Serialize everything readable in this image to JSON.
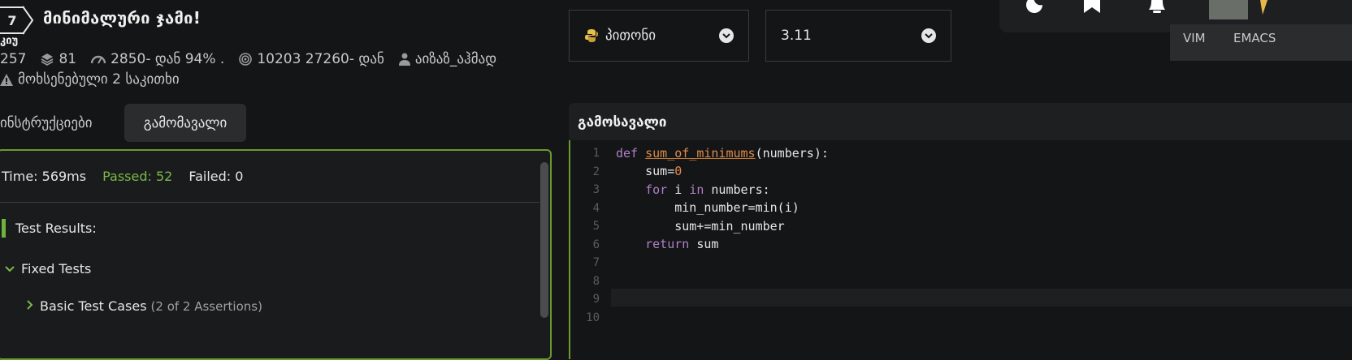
{
  "kata": {
    "rank": "7",
    "rank_label": "კიუ",
    "title": "მინიმალური ჯამი!",
    "stats": {
      "completed": "257",
      "collections": "81",
      "satisfaction": "2850- დან 94% .",
      "stars": "10203 27260- დან",
      "author": "აიზაზ_აჰმად"
    },
    "issues": "მოხსენებული 2 საკითხი"
  },
  "tabs": {
    "instructions": "ინსტრუქციები",
    "output": "გამომავალი"
  },
  "results": {
    "time": "Time: 569ms",
    "passed": "Passed: 52",
    "failed": "Failed: 0",
    "title": "Test Results:",
    "fixed": "Fixed Tests",
    "basic": "Basic Test Cases",
    "basic_count": "(2 of 2 Assertions)"
  },
  "language": {
    "label": "პითონი",
    "version": "3.11"
  },
  "editor": {
    "title": "გამოსავალი",
    "modes": [
      "VIM",
      "EMACS"
    ],
    "line_numbers": [
      "1",
      "2",
      "3",
      "4",
      "5",
      "6",
      "7",
      "8",
      "9",
      "10"
    ],
    "code": {
      "l1_def": "def",
      "l1_fn": "sum_of_minimums",
      "l1_rest": "(numbers):",
      "l2_a": "    sum=",
      "l2_num": "0",
      "l3_for": "for",
      "l3_i": " i ",
      "l3_in": "in",
      "l3_rest": " numbers:",
      "l4": "        min_number=min(i)",
      "l5": "        sum+=min_number",
      "l6_ret": "return",
      "l6_rest": " sum"
    }
  },
  "colors": {
    "accent_green": "#6a9a2f",
    "passed": "#79b94a",
    "keyword": "#b07fc7",
    "function": "#e08a4a"
  }
}
